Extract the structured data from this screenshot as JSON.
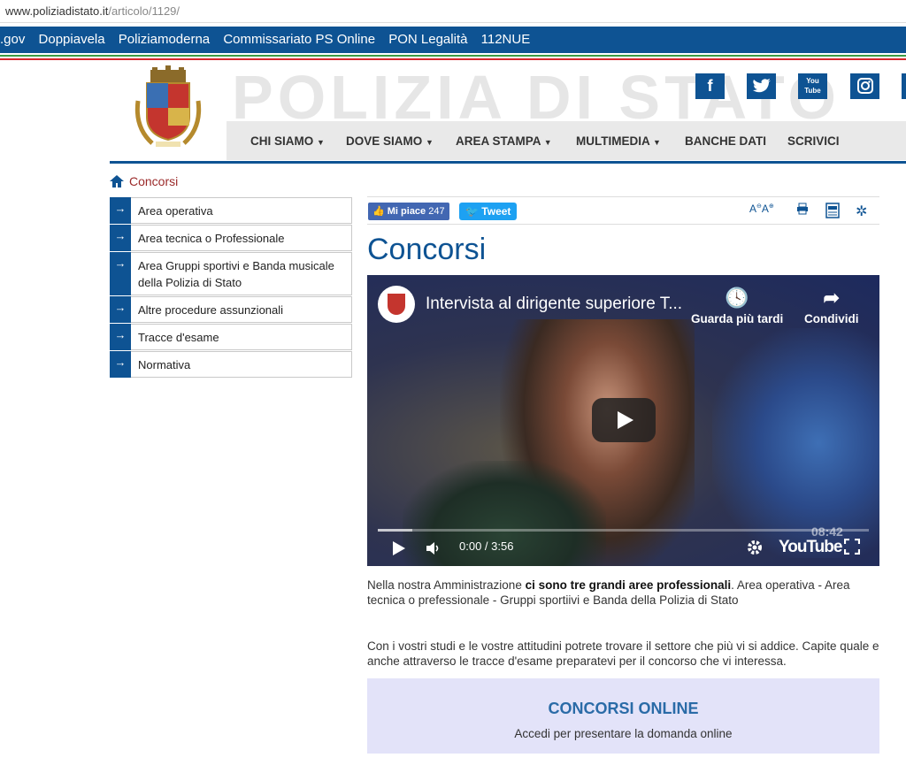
{
  "browser": {
    "url_host": "www.poliziadistato.it",
    "url_path": "/articolo/1129/"
  },
  "top_links": [
    ".gov",
    "Doppiavela",
    "Poliziamoderna",
    "Commissariato PS Online",
    "PON Legalità",
    "112NUE"
  ],
  "header": {
    "site_title": "POLIZIA DI STATO",
    "social": [
      "f",
      "t",
      "You Tube",
      "ig"
    ],
    "nav": [
      "CHI SIAMO",
      "DOVE SIAMO",
      "AREA STAMPA",
      "MULTIMEDIA",
      "BANCHE DATI",
      "SCRIVICI"
    ]
  },
  "breadcrumb": {
    "current": "Concorsi"
  },
  "sidebar": [
    "Area operativa",
    "Area tecnica o Professionale",
    "Area Gruppi sportivi e Banda musicale della Polizia di Stato",
    "Altre procedure assunzionali",
    "Tracce d'esame",
    "Normativa"
  ],
  "share": {
    "like_label": "Mi piace",
    "like_count": "247",
    "tweet_label": "Tweet"
  },
  "page_title": "Concorsi",
  "video": {
    "title": "Intervista al dirigente superiore T...",
    "watch_later": "Guarda più tardi",
    "share": "Condividi",
    "time": "0:00 / 3:56",
    "brand": "YouTube",
    "overlay_time": "08:42",
    "progress": 0.07
  },
  "body": {
    "p1_start": "Nella nostra Amministrazione ",
    "p1_bold": "ci sono tre grandi aree professionali",
    "p1_end": ". Area operativa - Area tecnica o prefessionale - Gruppi sportiivi e Banda della Polizia di Stato",
    "p2": "Con i vostri studi e le vostre attitudini potrete trovare il settore che più vi si addice. Capite quale e anche attraverso le tracce d'esame preparatevi per il concorso che vi interessa."
  },
  "concorsi_box": {
    "title": "CONCORSI ONLINE",
    "subtitle": "Accedi per presentare la domanda online"
  },
  "colors": {
    "primary": "#0e5393",
    "crumb": "#9b2a2a",
    "box_bg": "#e3e3f9"
  }
}
